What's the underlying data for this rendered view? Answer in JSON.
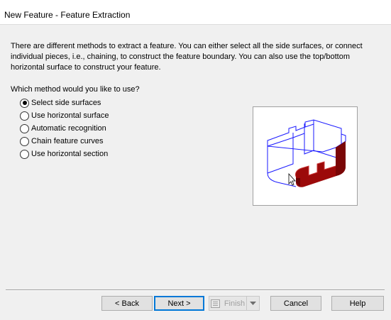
{
  "window": {
    "title": "New Feature - Feature Extraction"
  },
  "intro": {
    "line1": "There are different methods to extract a feature.  You can either select all the side surfaces, or connect",
    "line2": "individual pieces, i.e., chaining, to construct the feature boundary.  You can also use the top/bottom",
    "line3": "horizontal surface to construct your feature."
  },
  "question": "Which method would you like to use?",
  "options": [
    {
      "label": "Select side surfaces",
      "checked": true
    },
    {
      "label": "Use horizontal surface",
      "checked": false
    },
    {
      "label": "Automatic recognition",
      "checked": false
    },
    {
      "label": "Chain feature curves",
      "checked": false
    },
    {
      "label": "Use horizontal section",
      "checked": false
    }
  ],
  "buttons": {
    "back": "< Back",
    "next": "Next >",
    "finish": "Finish",
    "cancel": "Cancel",
    "help": "Help"
  },
  "colors": {
    "wireframe": "#1a1aff",
    "surface": "#9c0a0a",
    "accent": "#0078d7"
  },
  "icons": {
    "finish": "finish-icon",
    "dropdown": "chevron-down-icon",
    "cursor": "mouse-pointer-icon"
  }
}
